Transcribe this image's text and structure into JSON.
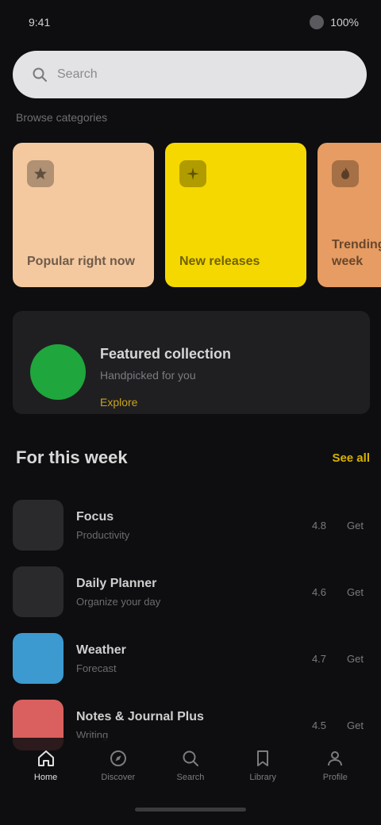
{
  "status": {
    "time": "9:41",
    "battery": "100%"
  },
  "search": {
    "placeholder": "Search"
  },
  "section_caption": "Browse categories",
  "categories": [
    {
      "label": "Popular right now",
      "color": "#f4c9a0"
    },
    {
      "label": "New releases",
      "color": "#f5d800"
    },
    {
      "label": "Trending this week",
      "color": "#e69c62"
    }
  ],
  "featured": {
    "title": "Featured collection",
    "subtitle": "Handpicked for you",
    "link": "Explore",
    "logo_color": "#1fa63c"
  },
  "list": {
    "title": "For this week",
    "see_all": "See all",
    "items": [
      {
        "title": "Focus",
        "subtitle": "Productivity",
        "meta1": "4.8",
        "meta2": "Get",
        "icon_color": "#2a2a2d"
      },
      {
        "title": "Daily Planner",
        "subtitle": "Organize your day",
        "meta1": "4.6",
        "meta2": "Get",
        "icon_color": "#2a2a2d"
      },
      {
        "title": "Weather",
        "subtitle": "Forecast",
        "meta1": "4.7",
        "meta2": "Get",
        "icon_color": "#3c9ad0"
      },
      {
        "title": "Notes & Journal Plus",
        "subtitle": "Writing",
        "meta1": "4.5",
        "meta2": "Get",
        "icon_color": "#d9605e"
      }
    ]
  },
  "nav": [
    {
      "label": "Home",
      "icon": "home-icon"
    },
    {
      "label": "Discover",
      "icon": "compass-icon"
    },
    {
      "label": "Search",
      "icon": "search-icon"
    },
    {
      "label": "Library",
      "icon": "bookmark-icon"
    },
    {
      "label": "Profile",
      "icon": "user-icon"
    }
  ]
}
